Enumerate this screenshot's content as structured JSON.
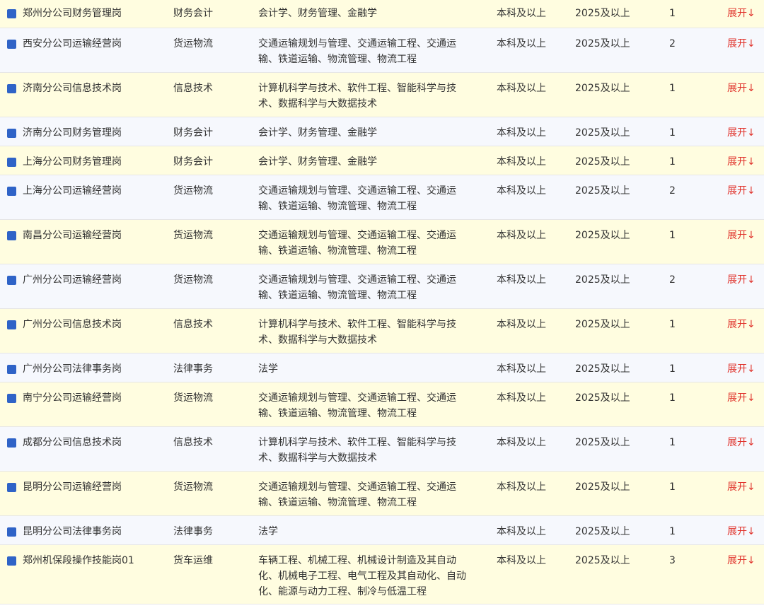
{
  "expand_label": "展开↓",
  "rows": [
    {
      "title": "郑州分公司财务管理岗",
      "category": "财务会计",
      "majors": "会计学、财务管理、金融学",
      "education": "本科及以上",
      "year": "2025及以上",
      "count": "1"
    },
    {
      "title": "西安分公司运输经营岗",
      "category": "货运物流",
      "majors": "交通运输规划与管理、交通运输工程、交通运输、铁道运输、物流管理、物流工程",
      "education": "本科及以上",
      "year": "2025及以上",
      "count": "2"
    },
    {
      "title": "济南分公司信息技术岗",
      "category": "信息技术",
      "majors": "计算机科学与技术、软件工程、智能科学与技术、数据科学与大数据技术",
      "education": "本科及以上",
      "year": "2025及以上",
      "count": "1"
    },
    {
      "title": "济南分公司财务管理岗",
      "category": "财务会计",
      "majors": "会计学、财务管理、金融学",
      "education": "本科及以上",
      "year": "2025及以上",
      "count": "1"
    },
    {
      "title": "上海分公司财务管理岗",
      "category": "财务会计",
      "majors": "会计学、财务管理、金融学",
      "education": "本科及以上",
      "year": "2025及以上",
      "count": "1"
    },
    {
      "title": "上海分公司运输经营岗",
      "category": "货运物流",
      "majors": "交通运输规划与管理、交通运输工程、交通运输、铁道运输、物流管理、物流工程",
      "education": "本科及以上",
      "year": "2025及以上",
      "count": "2"
    },
    {
      "title": "南昌分公司运输经营岗",
      "category": "货运物流",
      "majors": "交通运输规划与管理、交通运输工程、交通运输、铁道运输、物流管理、物流工程",
      "education": "本科及以上",
      "year": "2025及以上",
      "count": "1"
    },
    {
      "title": "广州分公司运输经营岗",
      "category": "货运物流",
      "majors": "交通运输规划与管理、交通运输工程、交通运输、铁道运输、物流管理、物流工程",
      "education": "本科及以上",
      "year": "2025及以上",
      "count": "2"
    },
    {
      "title": "广州分公司信息技术岗",
      "category": "信息技术",
      "majors": "计算机科学与技术、软件工程、智能科学与技术、数据科学与大数据技术",
      "education": "本科及以上",
      "year": "2025及以上",
      "count": "1"
    },
    {
      "title": "广州分公司法律事务岗",
      "category": "法律事务",
      "majors": "法学",
      "education": "本科及以上",
      "year": "2025及以上",
      "count": "1"
    },
    {
      "title": "南宁分公司运输经营岗",
      "category": "货运物流",
      "majors": "交通运输规划与管理、交通运输工程、交通运输、铁道运输、物流管理、物流工程",
      "education": "本科及以上",
      "year": "2025及以上",
      "count": "1"
    },
    {
      "title": "成都分公司信息技术岗",
      "category": "信息技术",
      "majors": "计算机科学与技术、软件工程、智能科学与技术、数据科学与大数据技术",
      "education": "本科及以上",
      "year": "2025及以上",
      "count": "1"
    },
    {
      "title": "昆明分公司运输经营岗",
      "category": "货运物流",
      "majors": "交通运输规划与管理、交通运输工程、交通运输、铁道运输、物流管理、物流工程",
      "education": "本科及以上",
      "year": "2025及以上",
      "count": "1"
    },
    {
      "title": "昆明分公司法律事务岗",
      "category": "法律事务",
      "majors": "法学",
      "education": "本科及以上",
      "year": "2025及以上",
      "count": "1"
    },
    {
      "title": "郑州机保段操作技能岗01",
      "category": "货车运维",
      "majors": "车辆工程、机械工程、机械设计制造及其自动化、机械电子工程、电气工程及其自动化、自动化、能源与动力工程、制冷与低温工程",
      "education": "本科及以上",
      "year": "2025及以上",
      "count": "3"
    }
  ]
}
